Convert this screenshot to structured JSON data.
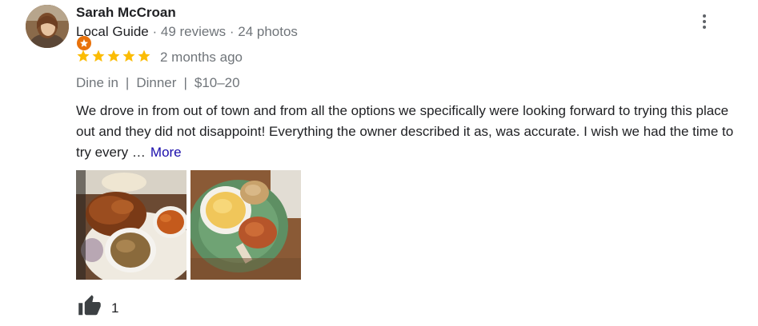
{
  "reviewer": {
    "name": "Sarah McCroan",
    "guide_label": "Local Guide",
    "reviews": "49 reviews",
    "photos": "24 photos",
    "avatar_icon": "user-avatar",
    "badge_icon": "local-guide-star-icon"
  },
  "rating": {
    "stars": 5,
    "max": 5,
    "star_color": "#fbbc04"
  },
  "time_ago": "2 months ago",
  "attributes": [
    "Dine in",
    "Dinner",
    "$10–20"
  ],
  "review_text": "We drove in from out of town and from all the options we specifically were looking forward to trying this place out and they did not disappoint! Everything the owner described it as, was accurate. I wish we had the time to try every …",
  "more_label": "More",
  "photos": [
    {
      "icon": "fried-chicken-plate-photo"
    },
    {
      "icon": "mac-and-cheese-plate-photo"
    }
  ],
  "like": {
    "icon": "thumbs-up-icon",
    "count": "1"
  },
  "menu_icon": "more-vert-icon",
  "colors": {
    "link": "#1a0dab",
    "muted": "#70757a",
    "badge": "#e8710a"
  }
}
